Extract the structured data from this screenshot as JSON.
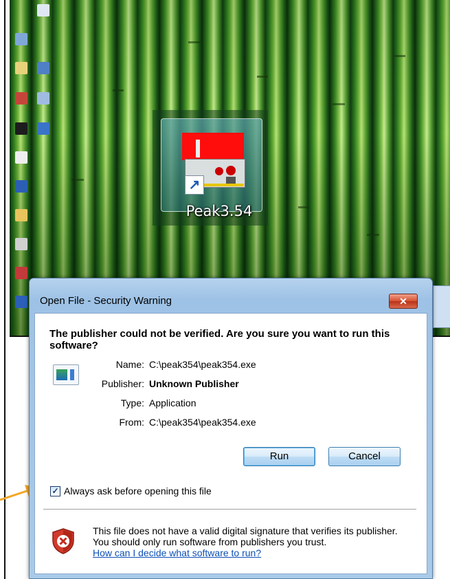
{
  "desktop": {
    "shortcut_label": "Peak3.54"
  },
  "dialog": {
    "title": "Open File - Security Warning",
    "close_glyph": "✕",
    "heading": "The publisher could not be verified.  Are you sure you want to run this software?",
    "rows": [
      {
        "label": "Name:",
        "value": "C:\\peak354\\peak354.exe",
        "bold": false
      },
      {
        "label": "Publisher:",
        "value": "Unknown Publisher",
        "bold": true
      },
      {
        "label": "Type:",
        "value": "Application",
        "bold": false
      },
      {
        "label": "From:",
        "value": "C:\\peak354\\peak354.exe",
        "bold": false
      }
    ],
    "run_label": "Run",
    "cancel_label": "Cancel",
    "checkbox_label": "Always ask before opening this file",
    "checkbox_checked": true,
    "checkbox_glyph": "✓",
    "warning_text": "This file does not have a valid digital signature that verifies its publisher.  You should only run software from publishers you trust.",
    "help_link": "How can I decide what software to run?"
  },
  "colors": {
    "pointer": "#f5a623",
    "close_button": "#d5502f",
    "link": "#0b4fb5"
  },
  "icons": [
    "shortcut-arrow-icon",
    "application-file-icon",
    "shield-error-icon",
    "close-icon",
    "checkbox-check-icon",
    "annotation-arrow-icon"
  ]
}
